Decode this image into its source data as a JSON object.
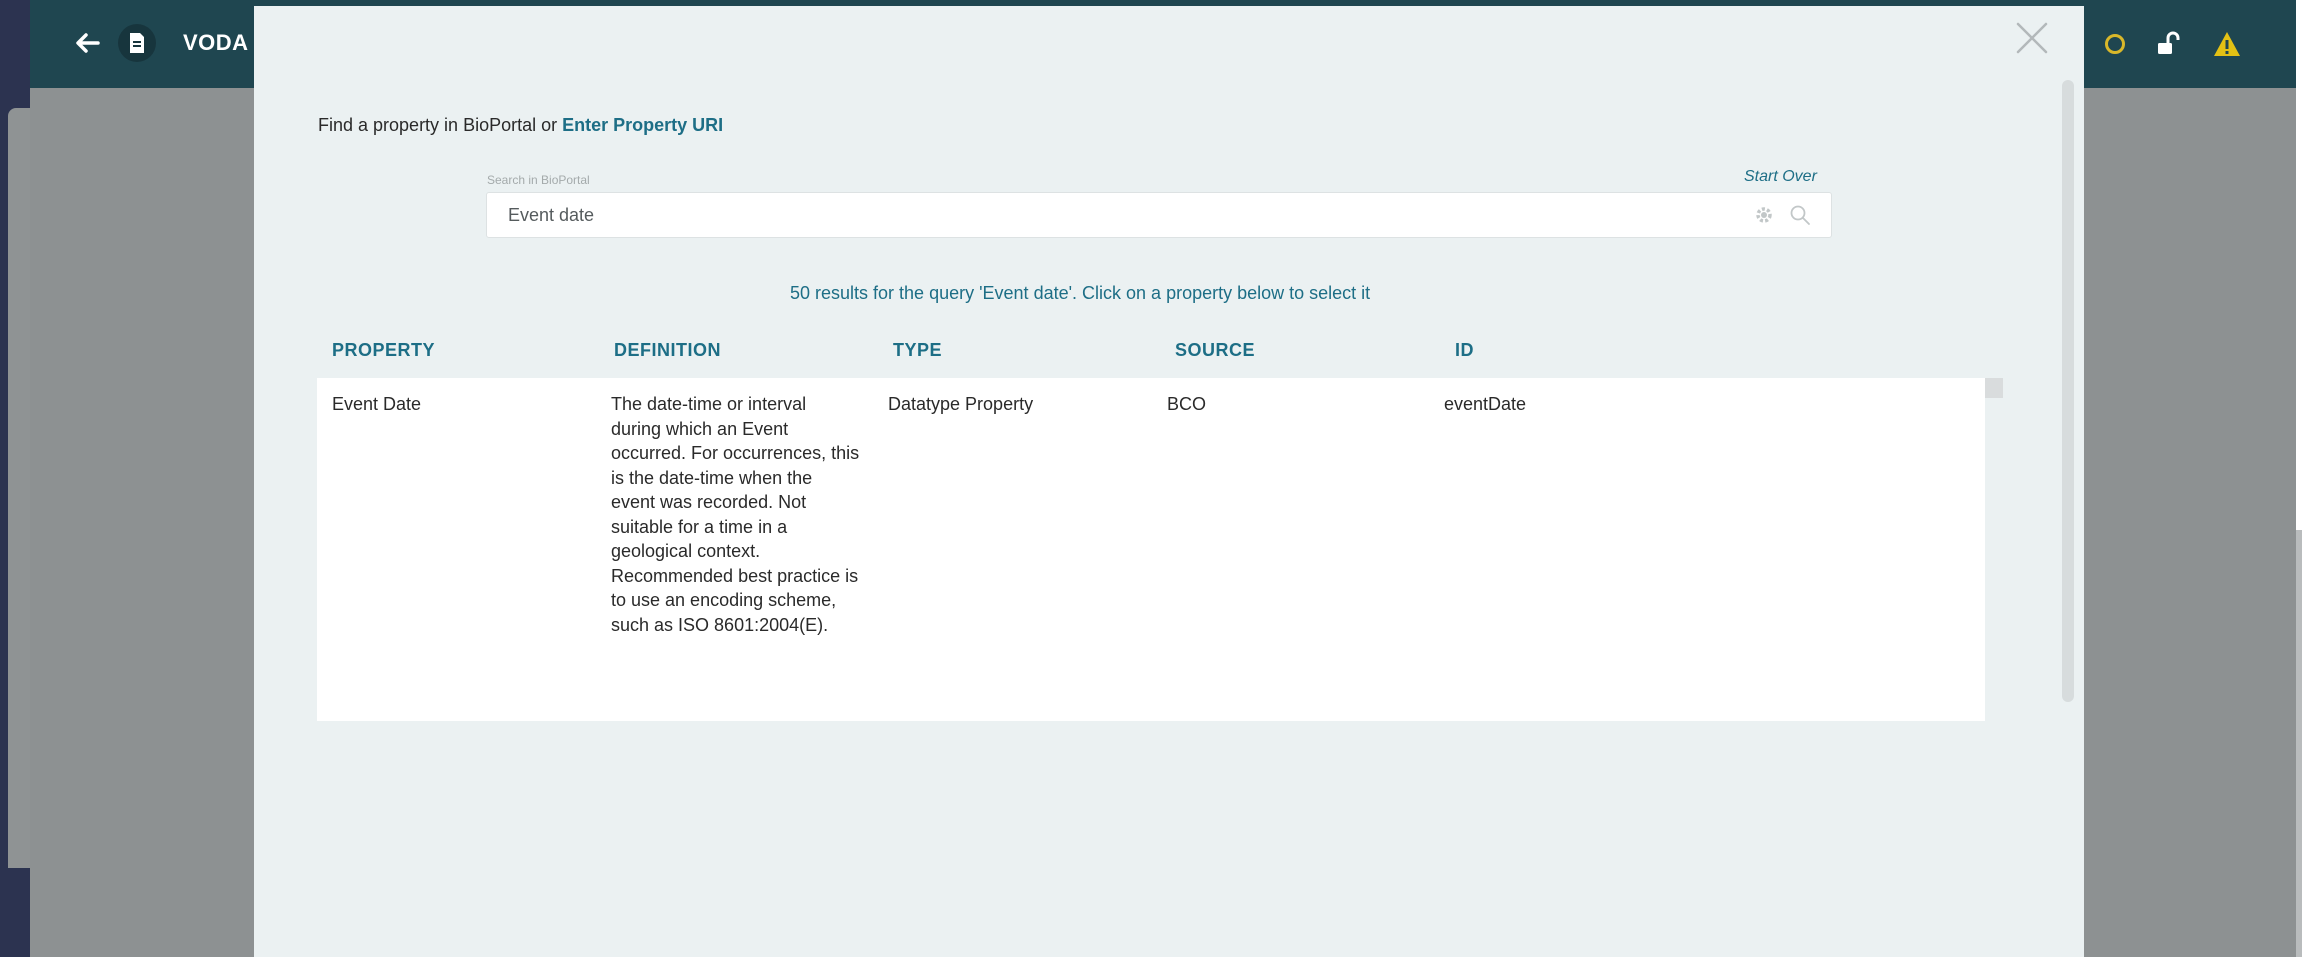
{
  "app": {
    "title": "VODA"
  },
  "modal": {
    "find_text": "Find a property in BioPortal or ",
    "enter_uri_link": "Enter Property URI",
    "search_label": "Search in BioPortal",
    "start_over": "Start Over",
    "search_value": "Event date",
    "results_summary": "50 results for the query 'Event date'. Click on a property below to select it",
    "columns": [
      "PROPERTY",
      "DEFINITION",
      "TYPE",
      "SOURCE",
      "ID"
    ],
    "rows": [
      {
        "property": "Event Date",
        "definition": "The date-time or interval during which an Event occurred. For occurrences, this is the date-time when the event was recorded. Not suitable for a time in a geological context. Recommended best practice is to use an encoding scheme, such as ISO 8601:2004(E).",
        "type": "Datatype Property",
        "source": "BCO",
        "id": "eventDate"
      }
    ]
  },
  "icons": {
    "back": "arrow-left-icon",
    "document": "document-icon",
    "status_ring": "circle-icon",
    "lock": "unlock-icon",
    "warning": "warning-icon",
    "close": "close-icon",
    "settings": "gear-icon",
    "search": "search-icon"
  },
  "colors": {
    "accent": "#1d6e86",
    "topbar": "#1f4650",
    "warning": "#e3c114",
    "modal_bg": "#ebf1f2"
  }
}
